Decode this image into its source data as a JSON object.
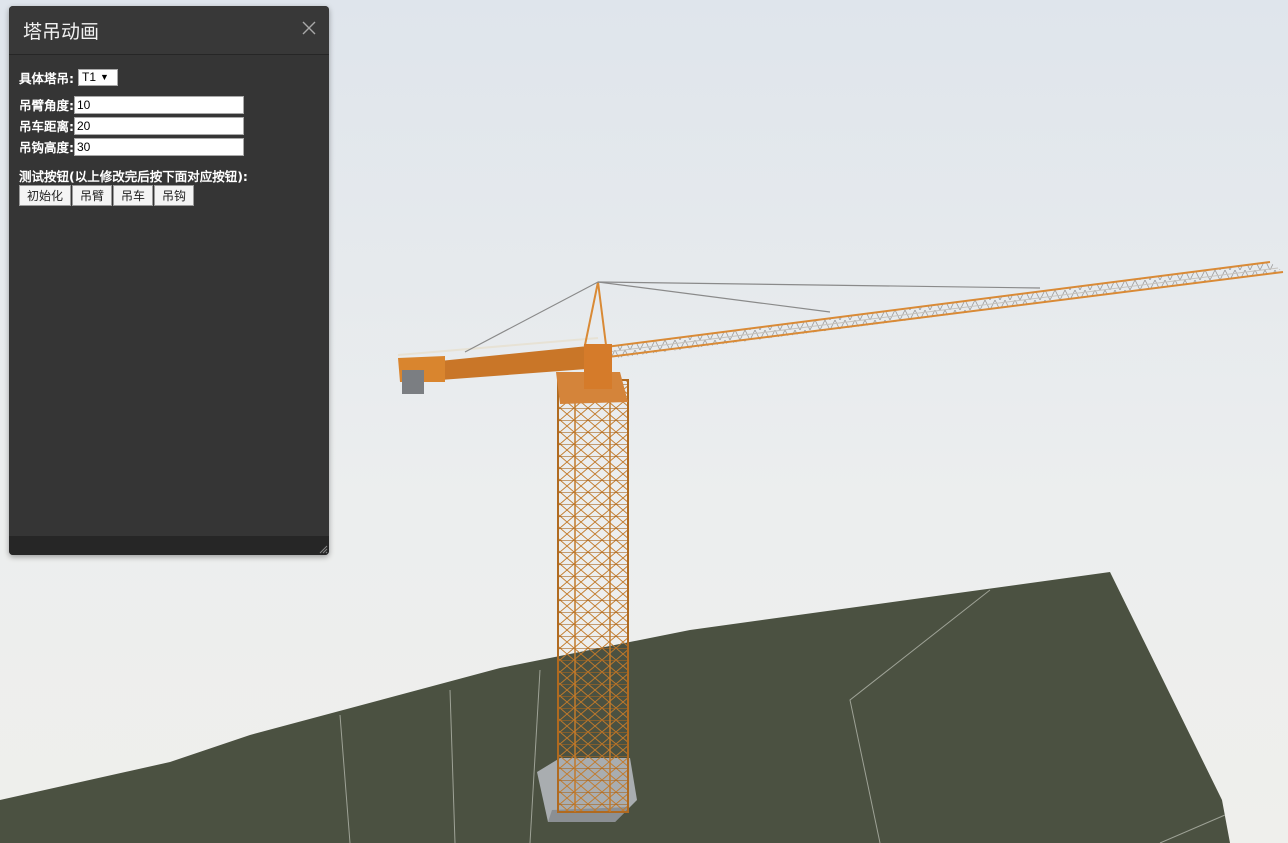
{
  "panel": {
    "title": "塔吊动画",
    "close_icon": "close-icon",
    "crane_select": {
      "label": "具体塔吊:",
      "value": "T1"
    },
    "fields": [
      {
        "label": "吊臂角度:",
        "value": "10"
      },
      {
        "label": "吊车距离:",
        "value": "20"
      },
      {
        "label": "吊钩高度:",
        "value": "30"
      }
    ],
    "test_label": "测试按钮(以上修改完后按下面对应按钮):",
    "buttons": [
      {
        "label": "初始化"
      },
      {
        "label": "吊臂"
      },
      {
        "label": "吊车"
      },
      {
        "label": "吊钩"
      }
    ]
  },
  "colors": {
    "panel_bg": "#353535",
    "crane_orange": "#d9882e",
    "ground": "#4a5040",
    "sky": "#e6ebf0"
  }
}
